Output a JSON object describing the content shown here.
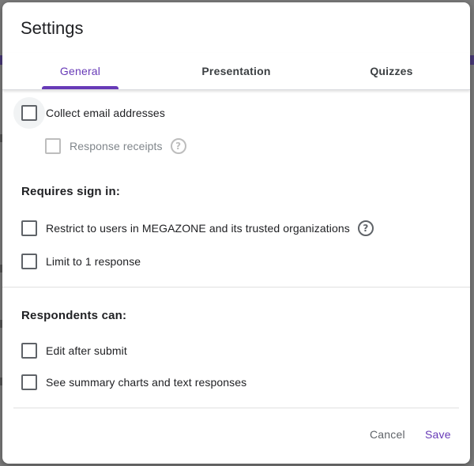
{
  "dialog": {
    "title": "Settings",
    "tabs": [
      {
        "label": "General",
        "active": true
      },
      {
        "label": "Presentation",
        "active": false
      },
      {
        "label": "Quizzes",
        "active": false
      }
    ],
    "general": {
      "collect_email": {
        "label": "Collect email addresses",
        "checked": false
      },
      "response_receipts": {
        "label": "Response receipts",
        "checked": false,
        "disabled": true
      },
      "requires_sign_in": {
        "heading": "Requires sign in:",
        "restrict_users": {
          "label": "Restrict to users in MEGAZONE and its trusted organizations",
          "checked": false
        },
        "limit_one": {
          "label": "Limit to 1 response",
          "checked": false
        }
      },
      "respondents_can": {
        "heading": "Respondents can:",
        "edit_after_submit": {
          "label": "Edit after submit",
          "checked": false
        },
        "see_summary": {
          "label": "See summary charts and text responses",
          "checked": false
        }
      }
    },
    "actions": {
      "cancel_label": "Cancel",
      "save_label": "Save"
    },
    "help_glyph": "?"
  },
  "colors": {
    "accent": "#673ab7",
    "overlay": "#7a7a7a",
    "text_primary": "#202124",
    "text_secondary": "#5f6368"
  },
  "icons": {
    "help": "help-circle-icon",
    "checkbox": "checkbox-unchecked-icon"
  }
}
